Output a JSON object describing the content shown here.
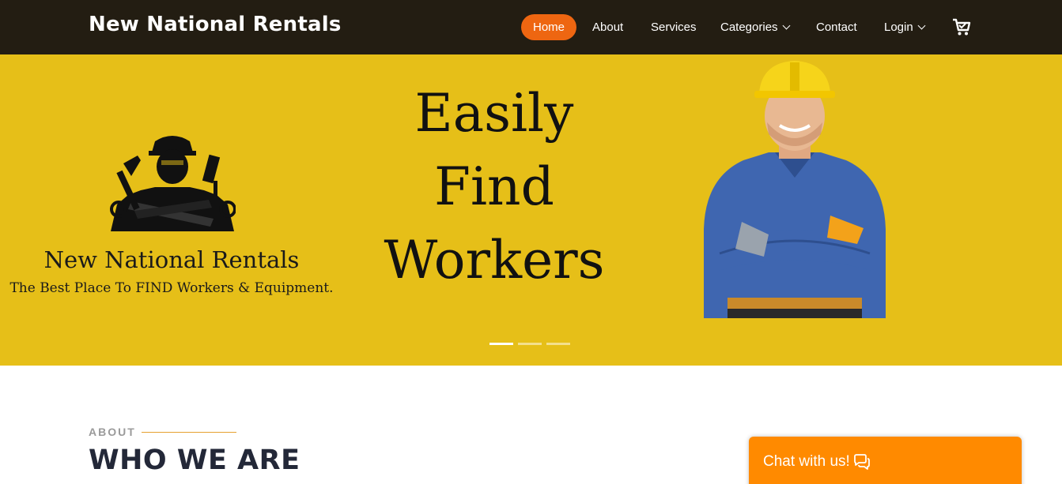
{
  "header": {
    "brand": "New National Rentals",
    "nav": [
      {
        "label": "Home",
        "active": true
      },
      {
        "label": "About"
      },
      {
        "label": "Services"
      },
      {
        "label": "Categories",
        "dropdown": true
      },
      {
        "label": "Contact"
      },
      {
        "label": "Login",
        "dropdown": true
      }
    ],
    "cart_icon": "shopping-cart-icon"
  },
  "hero": {
    "logo_title": "New National Rentals",
    "logo_tagline": "The Best Place To FIND Workers & Equipment.",
    "headline": [
      "Easily",
      "Find",
      "Workers"
    ],
    "slide_count": 3,
    "active_slide": 1,
    "background": "#e6bf18"
  },
  "about": {
    "eyebrow": "ABOUT",
    "title": "WHO WE ARE"
  },
  "chat": {
    "label": "Chat with us!",
    "icon": "chat-bubbles-icon"
  },
  "colors": {
    "header_bg": "#231d12",
    "accent": "#ee6611",
    "chat_bg": "#ff8a00"
  }
}
